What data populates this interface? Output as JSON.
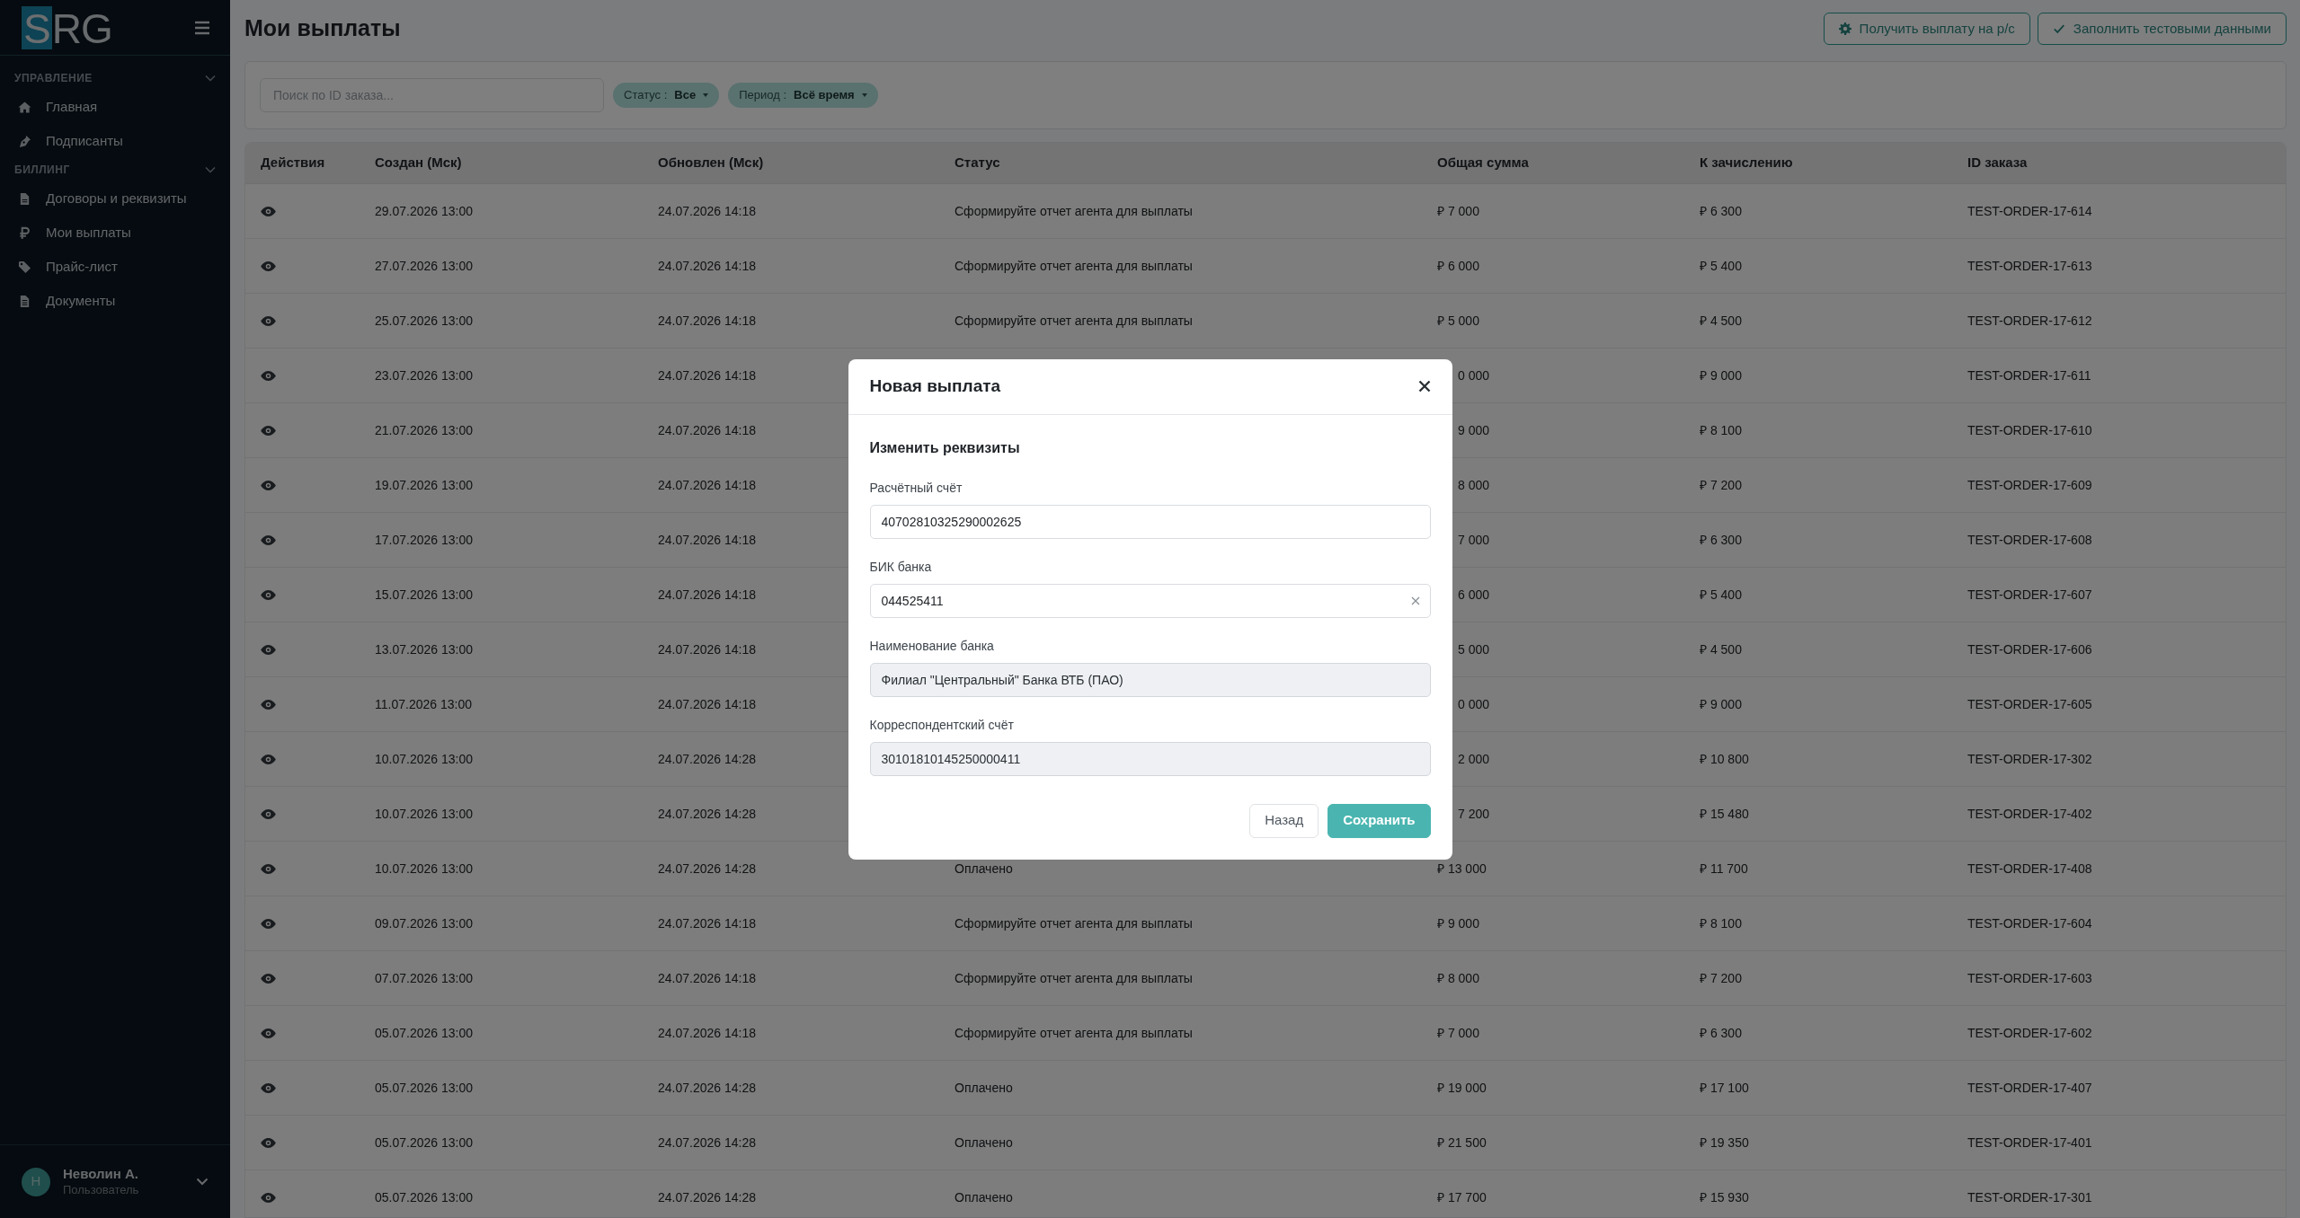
{
  "sidebar": {
    "logo": {
      "boxed_letter": "S",
      "rest": "RG"
    },
    "sections": [
      {
        "title": "УПРАВЛЕНИЕ",
        "expanded": true,
        "items": [
          {
            "label": "Главная"
          },
          {
            "label": "Подписанты"
          }
        ]
      },
      {
        "title": "БИЛЛИНГ",
        "expanded": true,
        "items": [
          {
            "label": "Договоры и реквизиты"
          },
          {
            "label": "Мои выплаты"
          },
          {
            "label": "Прайс-лист"
          },
          {
            "label": "Документы"
          }
        ]
      }
    ],
    "user": {
      "initial": "Н",
      "name": "Неволин А.",
      "role": "Пользователь"
    }
  },
  "page_title": "Мои выплаты",
  "header_buttons": [
    {
      "label": "Получить выплату на р/с"
    },
    {
      "label": "Заполнить тестовыми данными"
    }
  ],
  "filters": {
    "search": {
      "placeholder": "Поиск по ID заказа..."
    },
    "chips": [
      {
        "label": "Статус :",
        "value": "Все"
      },
      {
        "label": "Период :",
        "value": "Всё время"
      }
    ]
  },
  "table": {
    "columns": [
      "Действия",
      "Создан (Мск)",
      "Обновлен (Мск)",
      "Статус",
      "Общая сумма",
      "К зачислению",
      "ID заказа"
    ],
    "rows": [
      {
        "created": "29.07.2026 13:00",
        "updated": "24.07.2026 14:18",
        "status": "Сформируйте отчет агента для выплаты",
        "total": "₽ 7 000",
        "net": "₽ 6 300",
        "order_id": "TEST-ORDER-17-614",
        "covered": false
      },
      {
        "created": "27.07.2026 13:00",
        "updated": "24.07.2026 14:18",
        "status": "Сформируйте отчет агента для выплаты",
        "total": "₽ 6 000",
        "net": "₽ 5 400",
        "order_id": "TEST-ORDER-17-613",
        "covered": false
      },
      {
        "created": "25.07.2026 13:00",
        "updated": "24.07.2026 14:18",
        "status": "Сформируйте отчет агента для выплаты",
        "total": "₽ 5 000",
        "net": "₽ 4 500",
        "order_id": "TEST-ORDER-17-612",
        "covered": false
      },
      {
        "created": "23.07.2026 13:00",
        "updated": "24.07.2026 14:18",
        "total": "0 000",
        "net": "₽ 9 000",
        "order_id": "TEST-ORDER-17-611",
        "covered": true
      },
      {
        "created": "21.07.2026 13:00",
        "updated": "24.07.2026 14:18",
        "total": "9 000",
        "net": "₽ 8 100",
        "order_id": "TEST-ORDER-17-610",
        "covered": true
      },
      {
        "created": "19.07.2026 13:00",
        "updated": "24.07.2026 14:18",
        "total": "8 000",
        "net": "₽ 7 200",
        "order_id": "TEST-ORDER-17-609",
        "covered": true
      },
      {
        "created": "17.07.2026 13:00",
        "updated": "24.07.2026 14:18",
        "total": "7 000",
        "net": "₽ 6 300",
        "order_id": "TEST-ORDER-17-608",
        "covered": true
      },
      {
        "created": "15.07.2026 13:00",
        "updated": "24.07.2026 14:18",
        "total": "6 000",
        "net": "₽ 5 400",
        "order_id": "TEST-ORDER-17-607",
        "covered": true
      },
      {
        "created": "13.07.2026 13:00",
        "updated": "24.07.2026 14:18",
        "total": "5 000",
        "net": "₽ 4 500",
        "order_id": "TEST-ORDER-17-606",
        "covered": true
      },
      {
        "created": "11.07.2026 13:00",
        "updated": "24.07.2026 14:18",
        "total": "0 000",
        "net": "₽ 9 000",
        "order_id": "TEST-ORDER-17-605",
        "covered": true
      },
      {
        "created": "10.07.2026 13:00",
        "updated": "24.07.2026 14:28",
        "total": "2 000",
        "net": "₽ 10 800",
        "order_id": "TEST-ORDER-17-302",
        "covered": true
      },
      {
        "created": "10.07.2026 13:00",
        "updated": "24.07.2026 14:28",
        "total": "7 200",
        "net": "₽ 15 480",
        "order_id": "TEST-ORDER-17-402",
        "covered": true
      },
      {
        "created": "10.07.2026 13:00",
        "updated": "24.07.2026 14:28",
        "status": "Оплачено",
        "total": "₽ 13 000",
        "net": "₽ 11 700",
        "order_id": "TEST-ORDER-17-408",
        "covered": false
      },
      {
        "created": "09.07.2026 13:00",
        "updated": "24.07.2026 14:18",
        "status": "Сформируйте отчет агента для выплаты",
        "total": "₽ 9 000",
        "net": "₽ 8 100",
        "order_id": "TEST-ORDER-17-604",
        "covered": false
      },
      {
        "created": "07.07.2026 13:00",
        "updated": "24.07.2026 14:18",
        "status": "Сформируйте отчет агента для выплаты",
        "total": "₽ 8 000",
        "net": "₽ 7 200",
        "order_id": "TEST-ORDER-17-603",
        "covered": false
      },
      {
        "created": "05.07.2026 13:00",
        "updated": "24.07.2026 14:18",
        "status": "Сформируйте отчет агента для выплаты",
        "total": "₽ 7 000",
        "net": "₽ 6 300",
        "order_id": "TEST-ORDER-17-602",
        "covered": false
      },
      {
        "created": "05.07.2026 13:00",
        "updated": "24.07.2026 14:28",
        "status": "Оплачено",
        "total": "₽ 19 000",
        "net": "₽ 17 100",
        "order_id": "TEST-ORDER-17-407",
        "covered": false
      },
      {
        "created": "05.07.2026 13:00",
        "updated": "24.07.2026 14:28",
        "status": "Оплачено",
        "total": "₽ 21 500",
        "net": "₽ 19 350",
        "order_id": "TEST-ORDER-17-401",
        "covered": false
      },
      {
        "created": "05.07.2026 13:00",
        "updated": "24.07.2026 14:28",
        "status": "Оплачено",
        "total": "₽ 17 700",
        "net": "₽ 15 930",
        "order_id": "TEST-ORDER-17-301",
        "covered": false
      }
    ]
  },
  "modal": {
    "title": "Новая выплата",
    "subtitle": "Изменить реквизиты",
    "fields": [
      {
        "label": "Расчётный счёт",
        "value": "40702810325290002625",
        "readonly": false,
        "clearable": false
      },
      {
        "label": "БИК банка",
        "value": "044525411",
        "readonly": false,
        "clearable": true
      },
      {
        "label": "Наименование банка",
        "value": "Филиал \"Центральный\" Банка ВТБ (ПАО)",
        "readonly": true,
        "clearable": false
      },
      {
        "label": "Корреспондентский счёт",
        "value": "30101810145250000411",
        "readonly": true,
        "clearable": false
      }
    ],
    "buttons": [
      {
        "label": "Назад",
        "kind": "secondary"
      },
      {
        "label": "Сохранить",
        "kind": "primary"
      }
    ]
  }
}
